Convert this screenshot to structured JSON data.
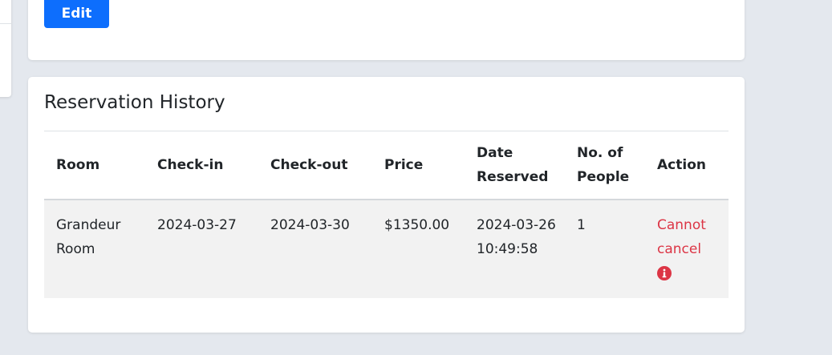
{
  "profile": {
    "edit_label": "Edit"
  },
  "history": {
    "title": "Reservation History",
    "columns": {
      "room": "Room",
      "check_in": "Check-in",
      "check_out": "Check-out",
      "price": "Price",
      "date_reserved": "Date Reserved",
      "people": "No. of People",
      "action": "Action"
    },
    "rows": [
      {
        "room": "Grandeur Room",
        "check_in": "2024-03-27",
        "check_out": "2024-03-30",
        "price": "$1350.00",
        "date_reserved": "2024-03-26 10:49:58",
        "people": "1",
        "action": "Cannot cancel",
        "action_icon": "info-circle-icon"
      }
    ]
  },
  "colors": {
    "background": "#e4e8ee",
    "primary_button": "#0d6efd",
    "danger_text": "#dc3545",
    "row_background": "#f2f2f2"
  }
}
